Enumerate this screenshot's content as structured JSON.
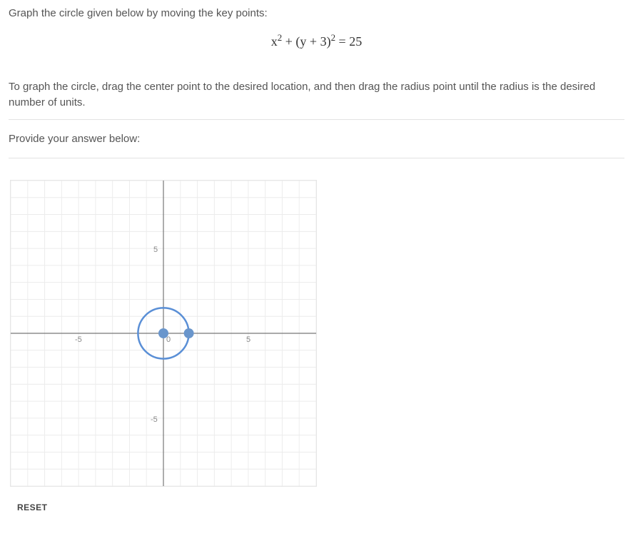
{
  "question": {
    "prompt": "Graph the circle given below by moving the key points:",
    "equation_html": "x<sup>2</sup> + (y + 3)<sup>2</sup> = 25",
    "instruction": "To graph the circle, drag the center point to the desired location, and then drag the radius point until the radius is the desired number of units.",
    "answer_label": "Provide your answer below:"
  },
  "graph": {
    "x_range": [
      -9,
      9
    ],
    "y_range": [
      -9,
      9
    ],
    "ticks": {
      "neg5": "-5",
      "pos5": "5",
      "origin": "0"
    },
    "circle": {
      "center": [
        0,
        0
      ],
      "radius": 1.5
    },
    "center_point": [
      0,
      0
    ],
    "radius_point": [
      1.5,
      0
    ]
  },
  "controls": {
    "reset_label": "RESET"
  },
  "chart_data": {
    "type": "scatter",
    "title": "",
    "xlabel": "",
    "ylabel": "",
    "xlim": [
      -9,
      9
    ],
    "ylim": [
      -9,
      9
    ],
    "series": [
      {
        "name": "circle-outline",
        "kind": "circle",
        "center": [
          0,
          0
        ],
        "radius": 1.5
      },
      {
        "name": "center-point",
        "x": [
          0
        ],
        "y": [
          0
        ]
      },
      {
        "name": "radius-point",
        "x": [
          1.5
        ],
        "y": [
          0
        ]
      }
    ],
    "annotations": [
      "-5",
      "5",
      "0"
    ]
  }
}
